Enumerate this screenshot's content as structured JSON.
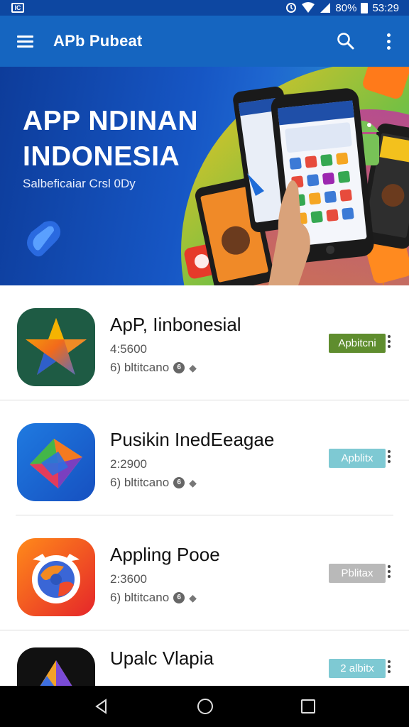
{
  "status_bar": {
    "app_icon": "IC",
    "battery": "80%",
    "time": "53:29",
    "icons": [
      "alarm-icon",
      "wifi-icon",
      "signal-icon",
      "battery-icon"
    ]
  },
  "app_bar": {
    "title": "APb Pubeat",
    "icons": [
      "menu-icon",
      "search-icon",
      "more-vert-icon"
    ]
  },
  "banner": {
    "title_line1": "APP NDINAN",
    "title_line2": "INDONESIA",
    "subtitle": "Salbeficaiar Crsl 0Dy"
  },
  "apps": [
    {
      "name": "ApP, Iinbonesial",
      "rating": "4:5600",
      "meta": "6) bltitcano",
      "button": "Apbitcni",
      "button_color": "#5f8d2e",
      "icon": "star-app-icon"
    },
    {
      "name": "Pusikin InedEeagae",
      "rating": "2:2900",
      "meta": "6) bltitcano",
      "button": "Apblitx",
      "button_color": "#7ec9d3",
      "icon": "origami-app-icon"
    },
    {
      "name": "Appling Pooe",
      "rating": "2:3600",
      "meta": "6) bltitcano",
      "button": "Pblitax",
      "button_color": "#b9b9b9",
      "icon": "browser-app-icon"
    },
    {
      "name": "Upalc Vlapia",
      "rating": "",
      "meta": "",
      "button": "2 albitx",
      "button_color": "#7ec9d3",
      "icon": "triangle-app-icon"
    }
  ],
  "nav_bar": {
    "icons": [
      "back-icon",
      "home-icon",
      "recents-icon"
    ]
  },
  "colors": {
    "app_bar": "#1565c0",
    "status_bar": "#0d47a1",
    "nav_bar": "#000000"
  }
}
